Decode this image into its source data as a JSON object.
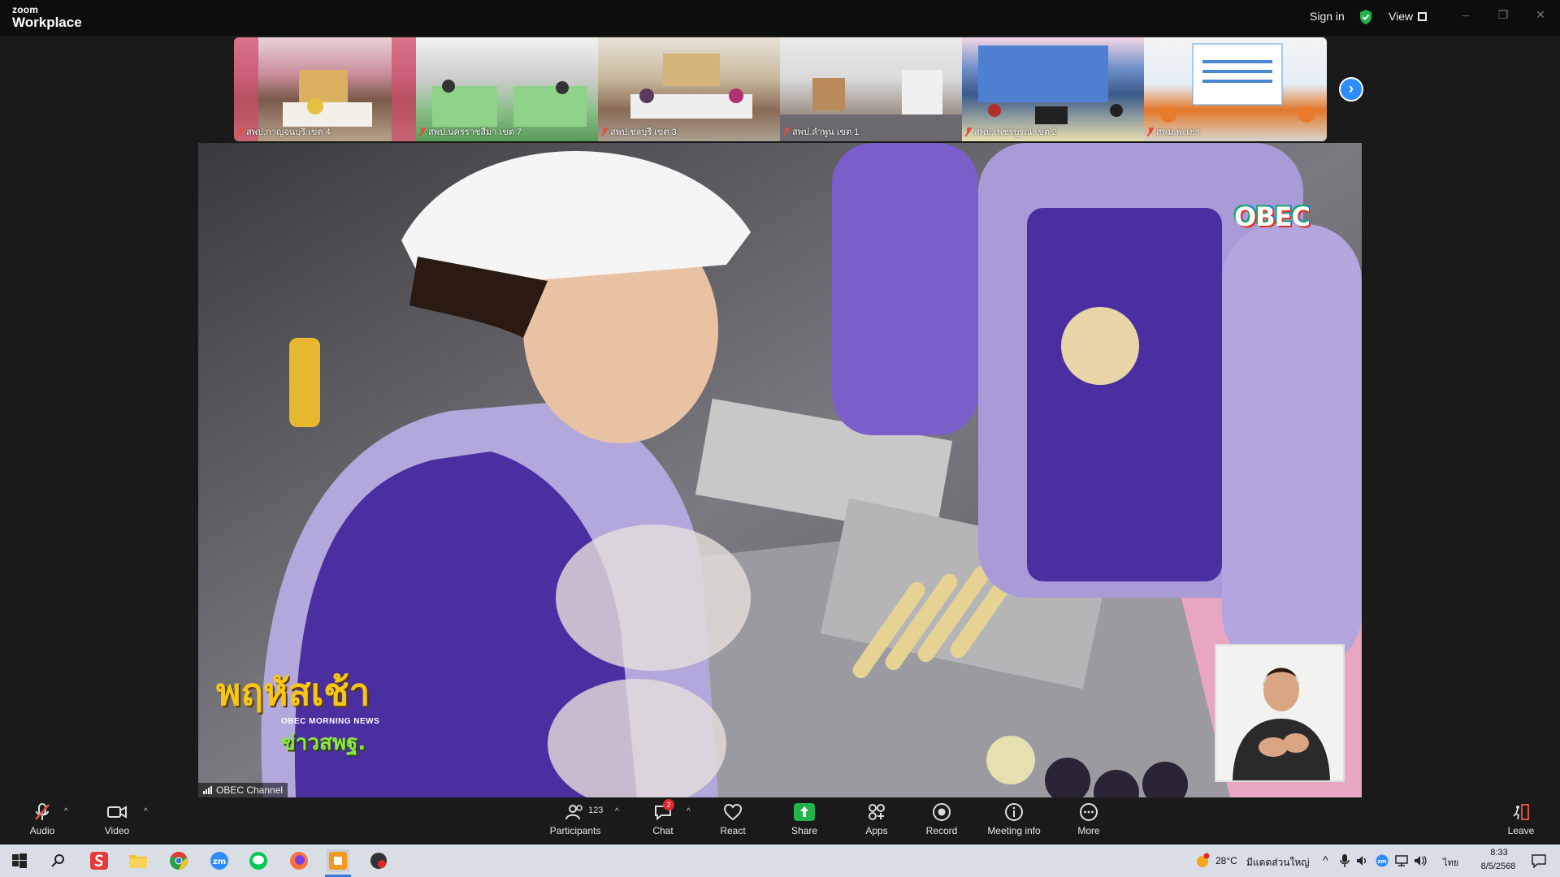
{
  "titlebar": {
    "brand_top": "zoom",
    "brand_bottom": "Workplace",
    "sign_in": "Sign in",
    "view": "View",
    "minimize": "–",
    "restore": "❐",
    "close": "✕"
  },
  "thumbnails": [
    {
      "name": "สพป.กาญจนบุรี เขต 4",
      "muted": true
    },
    {
      "name": "สพป.นครราชสีมา เขต 7",
      "muted": true
    },
    {
      "name": "สพป.ชลบุรี เขต 3",
      "muted": true
    },
    {
      "name": "สพป.ลำพูน เขต 1",
      "muted": true
    },
    {
      "name": "สพป.เพชรบูรณ์ เขต 2",
      "muted": true
    },
    {
      "name": "สพม.พะเยา",
      "muted": true
    }
  ],
  "main_video": {
    "channel_tag": "OBEC Channel",
    "watermark": "OBEC",
    "news_title": "พฤหัสเช้า",
    "news_subtitle": "OBEC MORNING NEWS",
    "news_tag": "ข่าวสพฐ."
  },
  "toolbar": {
    "audio": "Audio",
    "video": "Video",
    "participants": "Participants",
    "participants_count": "123",
    "chat": "Chat",
    "chat_badge": "2",
    "react": "React",
    "share": "Share",
    "apps": "Apps",
    "record": "Record",
    "meeting_info": "Meeting info",
    "more": "More",
    "leave": "Leave"
  },
  "taskbar": {
    "weather": "28°C",
    "weather_desc": "มีแดดส่วนใหญ่",
    "lang": "ไทย",
    "time": "8:33",
    "date": "8/5/2568"
  },
  "colors": {
    "accent": "#2d8cff",
    "share_green": "#24b24a",
    "muted_red": "#e74c3c",
    "toolbar_bg": "#1a1a1a"
  }
}
